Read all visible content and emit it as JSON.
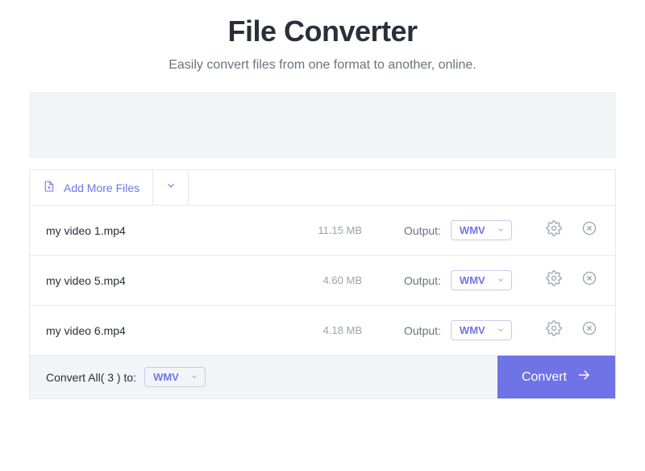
{
  "header": {
    "title": "File Converter",
    "subtitle": "Easily convert files from one format to another, online."
  },
  "toolbar": {
    "add_files_label": "Add More Files"
  },
  "files": [
    {
      "name": "my video 1.mp4",
      "size": "11.15 MB",
      "output_label": "Output:",
      "format": "WMV"
    },
    {
      "name": "my video 5.mp4",
      "size": "4.60 MB",
      "output_label": "Output:",
      "format": "WMV"
    },
    {
      "name": "my video 6.mp4",
      "size": "4.18 MB",
      "output_label": "Output:",
      "format": "WMV"
    }
  ],
  "footer": {
    "convert_all_prefix": "Convert All( ",
    "count": "3",
    "convert_all_suffix": " ) to:",
    "all_format": "WMV",
    "convert_label": "Convert"
  }
}
